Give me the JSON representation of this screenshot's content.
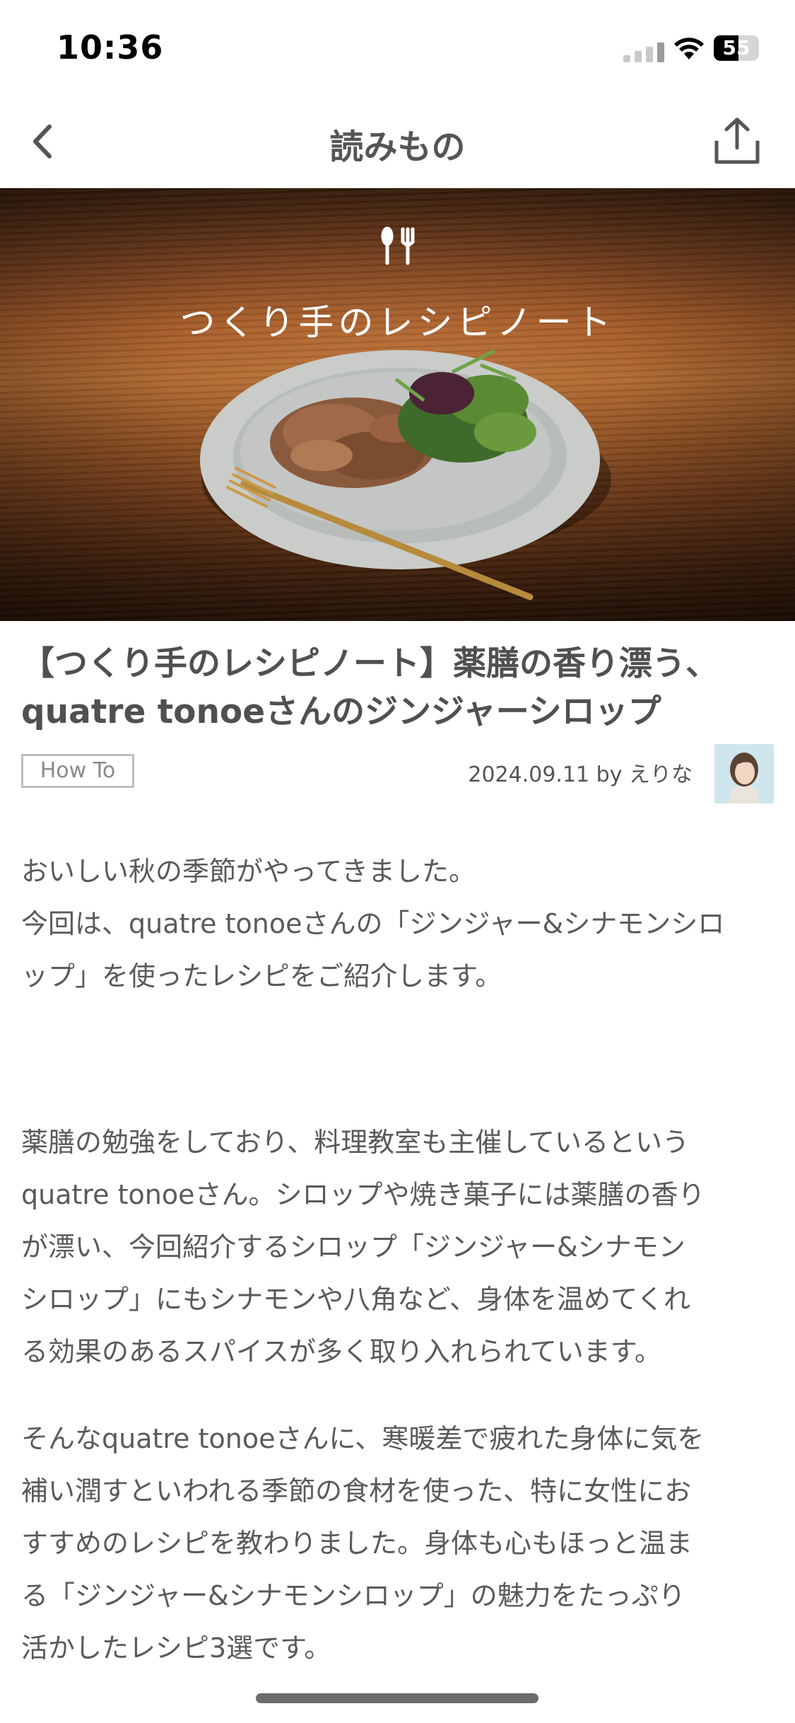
{
  "status_bar": {
    "time": "10:36",
    "battery_level": "55",
    "battery_fraction": 0.55
  },
  "nav": {
    "title": "読みもの",
    "back_icon": "chevron-left-icon",
    "share_icon": "share-icon"
  },
  "hero": {
    "caption": "つくり手のレシピノート"
  },
  "article": {
    "title_line1": "【つくり手のレシピノート】薬膳の香り漂う、",
    "title_line2": "quatre tonoeさんのジンジャーシロップ",
    "tag": "How To",
    "meta": "2024.09.11 by えりな"
  },
  "body": {
    "p1_l1": "おいしい秋の季節がやってきました。",
    "p1_l2": "今回は、quatre tonoeさんの「ジンジャー&シナモンシロ",
    "p1_l3": "ップ」を使ったレシピをご紹介します。",
    "p2_l1": "薬膳の勉強をしており、料理教室も主催しているという",
    "p2_l2": "quatre tonoeさん。シロップや焼き菓子には薬膳の香り",
    "p2_l3": "が漂い、今回紹介するシロップ「ジンジャー&シナモン",
    "p2_l4": "シロップ」にもシナモンや八角など、身体を温めてくれ",
    "p2_l5": "る効果のあるスパイスが多く取り入れられています。",
    "p3_l1": "そんなquatre tonoeさんに、寒暖差で疲れた身体に気を",
    "p3_l2": "補い潤すといわれる季節の食材を使った、特に女性にお",
    "p3_l3": "すすめのレシピを教わりました。身体も心もほっと温ま",
    "p3_l4": "る「ジンジャー&シナモンシロップ」の魅力をたっぷり",
    "p3_l5": "活かしたレシピ3選です。"
  },
  "colors": {
    "text": "#5a5a5a",
    "title": "#505050",
    "tag_border": "#bdbdbd"
  }
}
